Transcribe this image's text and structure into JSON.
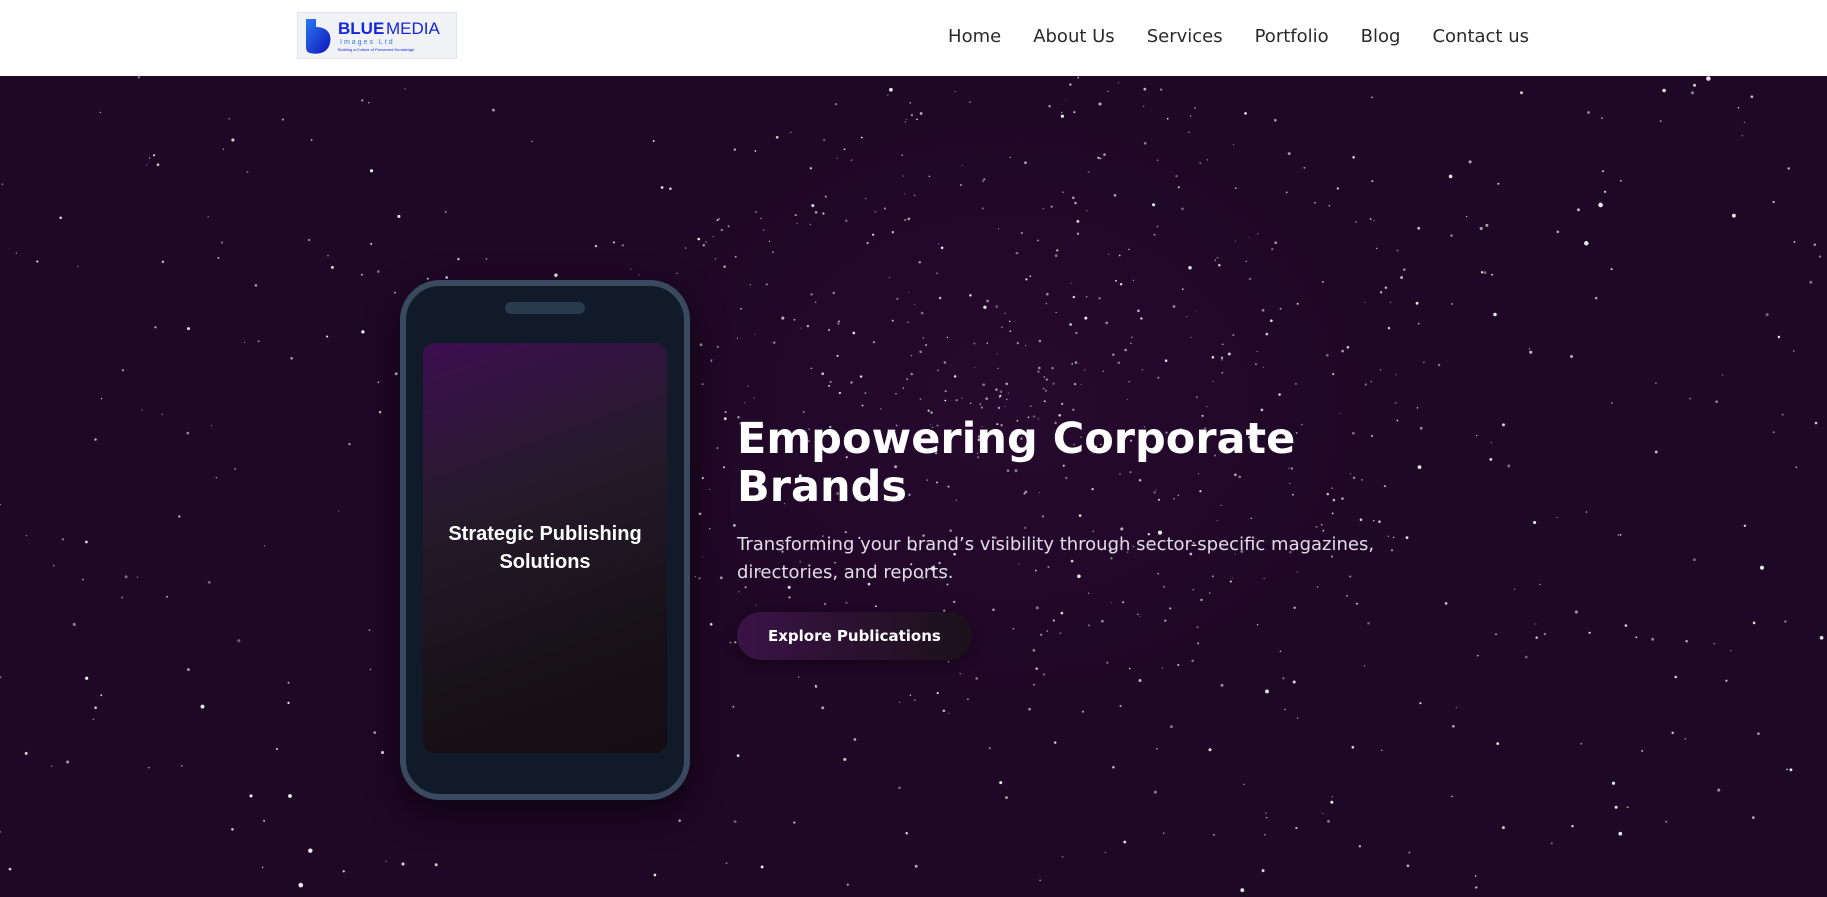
{
  "header": {
    "logo": {
      "brand_bold": "BLUE",
      "brand_light": "MEDIA",
      "sub": "Images Ltd",
      "tagline": "Building a Culture of Preserved Knowledge"
    },
    "nav": [
      {
        "label": "Home"
      },
      {
        "label": "About Us"
      },
      {
        "label": "Services"
      },
      {
        "label": "Portfolio"
      },
      {
        "label": "Blog"
      },
      {
        "label": "Contact us"
      }
    ]
  },
  "hero": {
    "phone_screen_text": "Strategic Publishing Solutions",
    "title": "Empowering Corporate Brands",
    "subtitle": "Transforming your brand’s visibility through sector-specific magazines, directories, and reports.",
    "cta_label": "Explore Publications"
  },
  "colors": {
    "hero_bg": "#1f0726",
    "brand_blue": "#1326e0",
    "phone_frame": "#3a4a5e",
    "cta_start": "#3a1346"
  }
}
